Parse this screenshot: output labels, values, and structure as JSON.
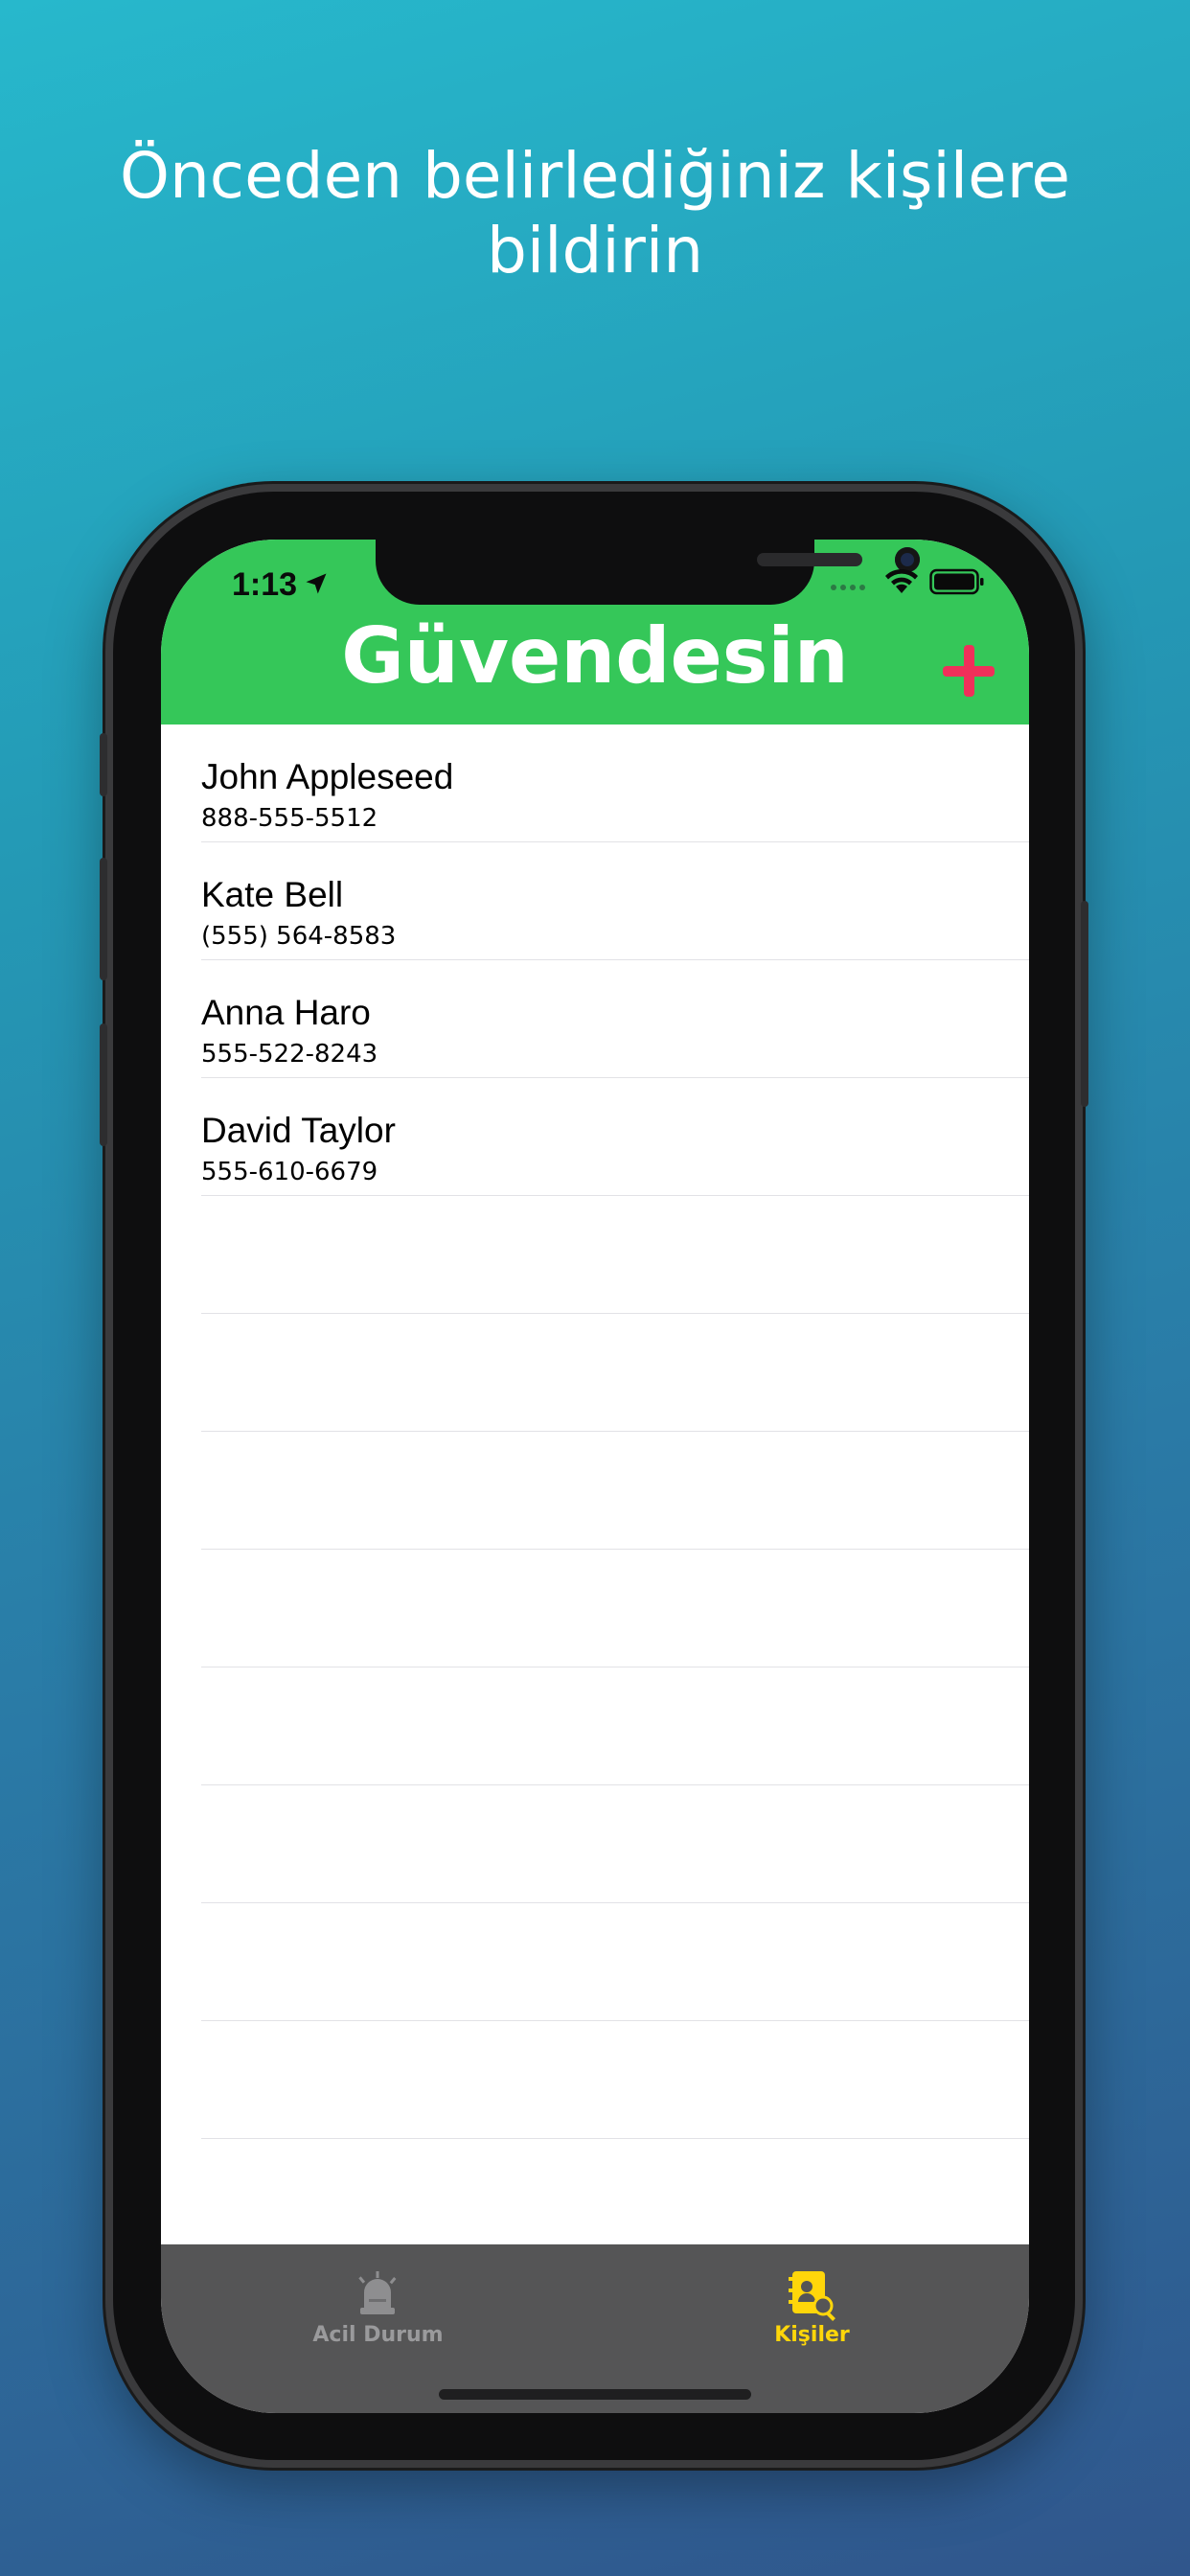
{
  "headline": {
    "line1": "Önceden belirlediğiniz kişilere",
    "line2": "bildirin"
  },
  "status_bar": {
    "time": "1:13",
    "icons": [
      "location-arrow-icon",
      "signal-dots-icon",
      "wifi-icon",
      "battery-icon"
    ]
  },
  "nav": {
    "title": "Güvendesin",
    "add_icon": "plus-icon",
    "background": "#35c759",
    "add_color": "#f0305a"
  },
  "contacts": [
    {
      "name": "John Appleseed",
      "phone": "888-555-5512"
    },
    {
      "name": "Kate Bell",
      "phone": "(555) 564-8583"
    },
    {
      "name": "Anna Haro",
      "phone": "555-522-8243"
    },
    {
      "name": "David Taylor",
      "phone": "555-610-6679"
    }
  ],
  "tabbar": {
    "tabs": [
      {
        "label": "Acil Durum",
        "icon": "siren-icon",
        "active": false
      },
      {
        "label": "Kişiler",
        "icon": "contacts-search-icon",
        "active": true
      }
    ],
    "active_color": "#ffd60a",
    "inactive_color": "#9a9a9c"
  }
}
